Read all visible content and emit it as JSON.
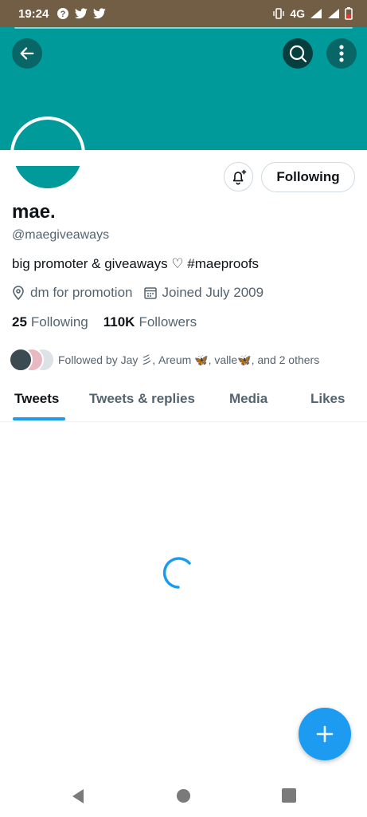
{
  "status_bar": {
    "time": "19:24",
    "network": "4G",
    "left_icons": [
      "help-icon",
      "twitter-icon",
      "twitter-icon"
    ],
    "right_icons": [
      "vibrate-icon",
      "signal-icon",
      "signal-icon",
      "battery-icon"
    ]
  },
  "header": {
    "banner_color": "#009a9a",
    "back_icon": "arrow-left-icon",
    "search_icon": "search-icon",
    "more_icon": "more-vertical-icon"
  },
  "actions": {
    "notify_icon": "bell-plus-icon",
    "following_label": "Following"
  },
  "profile": {
    "display_name": "mae.",
    "handle": "@maegiveaways",
    "bio": "big promoter & giveaways ♡ #maeproofs",
    "location": "dm for promotion",
    "joined": "Joined July 2009",
    "following_count": "25",
    "following_label": "Following",
    "followers_count": "110K",
    "followers_label": "Followers",
    "followed_by": "Followed by Jay 彡, Areum 🦋, valle🦋, and 2 others"
  },
  "tabs": [
    {
      "label": "Tweets",
      "active": true
    },
    {
      "label": "Tweets & replies",
      "active": false
    },
    {
      "label": "Media",
      "active": false
    },
    {
      "label": "Likes",
      "active": false
    }
  ],
  "accent_color": "#1d9bf0",
  "fab_icon": "plus-icon",
  "nav": [
    "back-icon",
    "home-icon",
    "recents-icon"
  ]
}
